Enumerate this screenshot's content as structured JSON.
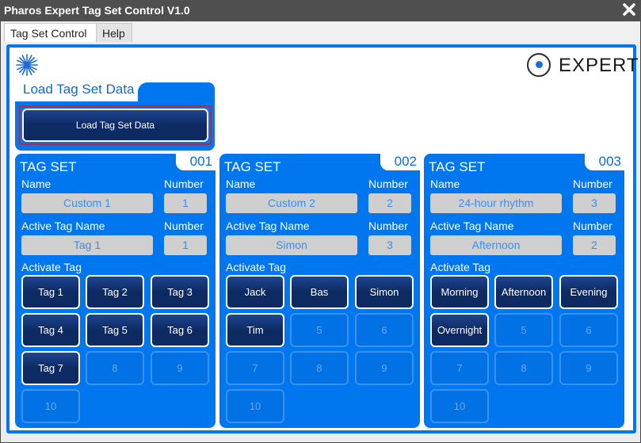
{
  "window": {
    "title": "Pharos Expert Tag Set Control V1.0",
    "close_label": "✖"
  },
  "menu": {
    "tabs": [
      {
        "label": "Tag Set Control"
      },
      {
        "label": "Help"
      }
    ]
  },
  "logo": {
    "text": "EXPERT"
  },
  "load": {
    "title": "Load Tag Set Data",
    "button_label": "Load Tag Set Data"
  },
  "labels": {
    "tag_set": "TAG SET",
    "name": "Name",
    "number": "Number",
    "active_tag_name": "Active Tag Name",
    "activate_tag": "Activate Tag"
  },
  "tagsets": [
    {
      "id": "001",
      "name": "Custom 1",
      "number": "1",
      "active_tag_name": "Tag 1",
      "active_number": "1",
      "tags": [
        "Tag 1",
        "Tag 2",
        "Tag 3",
        "Tag 4",
        "Tag 5",
        "Tag 6",
        "Tag 7",
        "8",
        "9",
        "10"
      ],
      "enabled": [
        true,
        true,
        true,
        true,
        true,
        true,
        true,
        false,
        false,
        false
      ]
    },
    {
      "id": "002",
      "name": "Custom 2",
      "number": "2",
      "active_tag_name": "Simon",
      "active_number": "3",
      "tags": [
        "Jack",
        "Bas",
        "Simon",
        "Tim",
        "5",
        "6",
        "7",
        "8",
        "9",
        "10"
      ],
      "enabled": [
        true,
        true,
        true,
        true,
        false,
        false,
        false,
        false,
        false,
        false
      ]
    },
    {
      "id": "003",
      "name": "24-hour rhythm",
      "number": "3",
      "active_tag_name": "Afternoon",
      "active_number": "2",
      "tags": [
        "Morning",
        "Afternoon",
        "Evening",
        "Overnight",
        "5",
        "6",
        "7",
        "8",
        "9",
        "10"
      ],
      "enabled": [
        true,
        true,
        true,
        true,
        false,
        false,
        false,
        false,
        false,
        false
      ]
    }
  ],
  "colors": {
    "accent": "#0077EE",
    "button_dark": "#0D2A63",
    "field_bg": "#CFCFCF",
    "field_text": "#3A8FF0",
    "highlight": "#C0243C"
  }
}
